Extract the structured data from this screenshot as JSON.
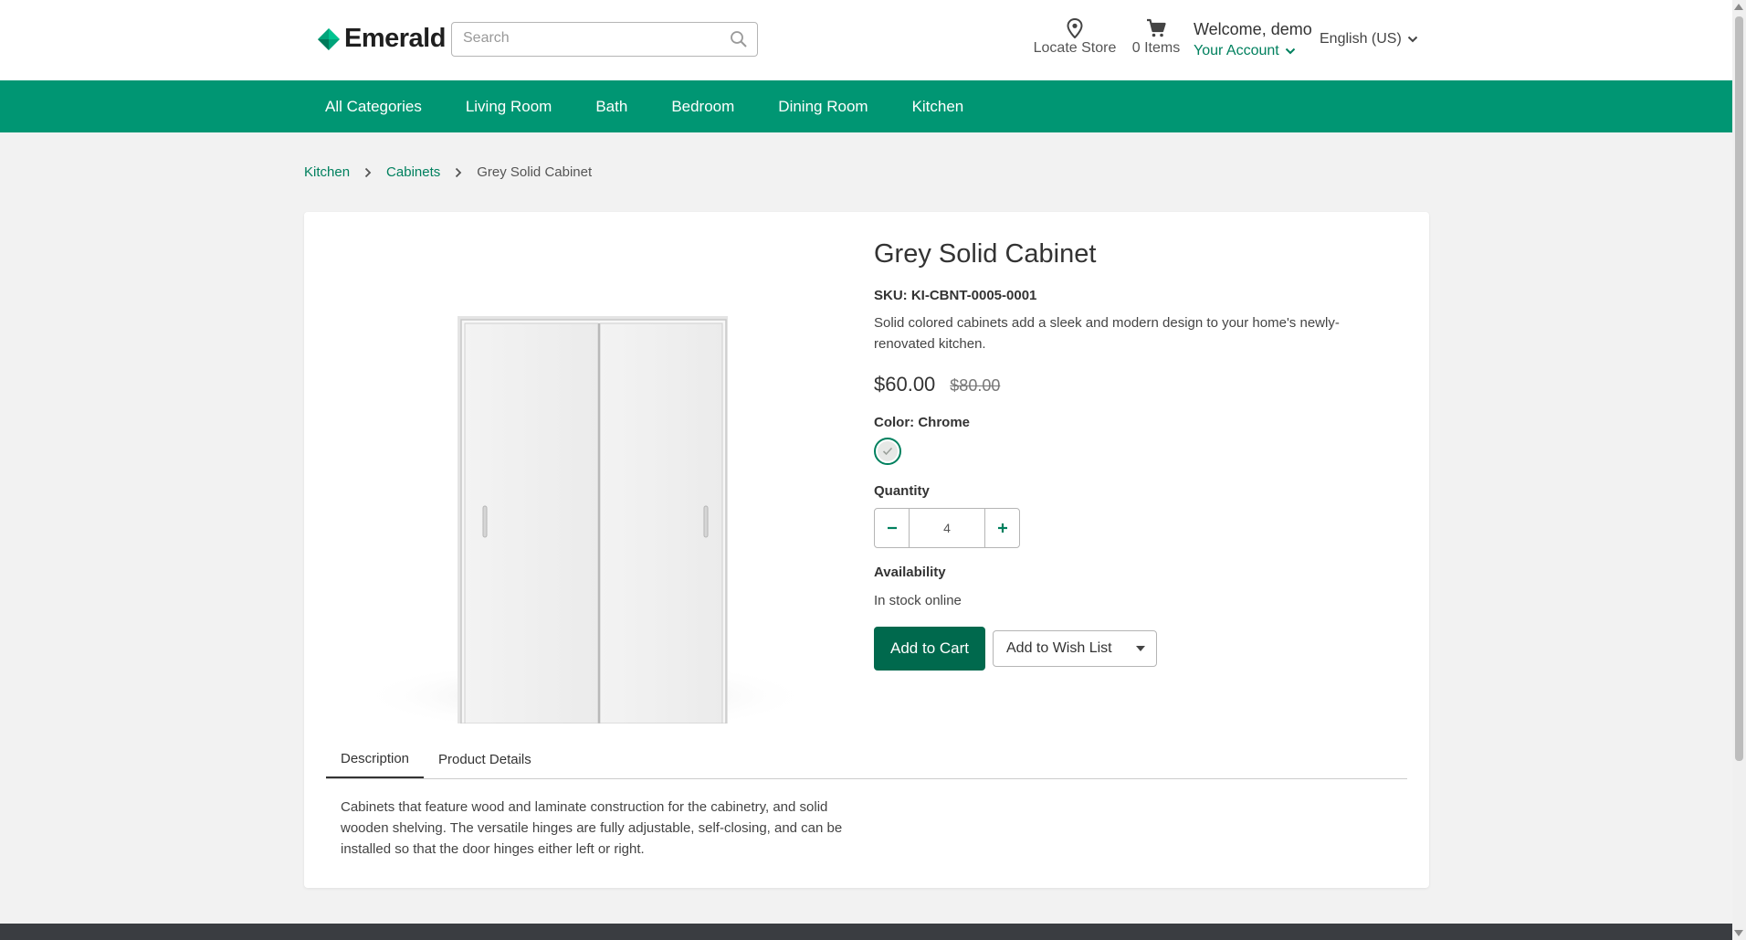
{
  "brand": {
    "name": "Emerald",
    "accent": "#009673",
    "dark_accent": "#00694d",
    "link": "#00805e"
  },
  "search": {
    "placeholder": "Search",
    "value": ""
  },
  "header": {
    "locate_label": "Locate Store",
    "cart_label": "0 Items",
    "welcome": "Welcome, demo",
    "account_label": "Your Account",
    "language": "English (US)"
  },
  "nav": {
    "items": [
      {
        "label": "All Categories"
      },
      {
        "label": "Living Room"
      },
      {
        "label": "Bath"
      },
      {
        "label": "Bedroom"
      },
      {
        "label": "Dining Room"
      },
      {
        "label": "Kitchen"
      }
    ]
  },
  "breadcrumb": {
    "items": [
      "Kitchen",
      "Cabinets"
    ],
    "current": "Grey Solid Cabinet"
  },
  "product": {
    "title": "Grey Solid Cabinet",
    "sku": "SKU: KI-CBNT-0005-0001",
    "description": "Solid colored cabinets add a sleek and modern design to your home's newly-renovated kitchen.",
    "price": "$60.00",
    "original_price": "$80.00",
    "color_label": "Color: Chrome",
    "quantity_label": "Quantity",
    "quantity": "4",
    "availability_label": "Availability",
    "availability": "In stock online",
    "add_to_cart": "Add to Cart",
    "add_to_wishlist": "Add to Wish List"
  },
  "tabs": {
    "items": [
      {
        "label": "Description"
      },
      {
        "label": "Product Details"
      }
    ],
    "active": "Description",
    "content": "Cabinets that feature wood and laminate construction for the cabinetry, and solid wooden shelving. The versatile hinges are fully adjustable, self-closing, and can be installed so that the door hinges either left or right."
  },
  "icons": {
    "logo": "emerald-diamond-icon",
    "search": "search-icon",
    "locate": "map-pin-icon",
    "cart": "cart-icon",
    "chevron": "chevron-down-icon",
    "check": "check-icon"
  }
}
